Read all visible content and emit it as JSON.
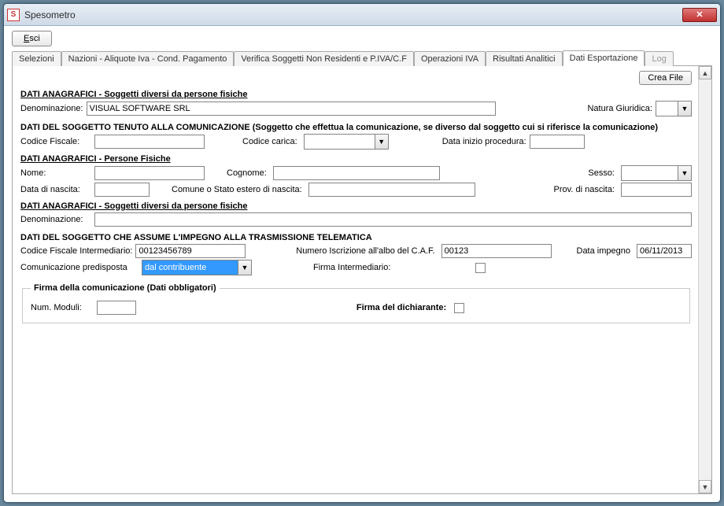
{
  "window": {
    "title": "Spesometro"
  },
  "toolbar": {
    "exit_pre": "E",
    "exit_rest": "sci"
  },
  "tabs": [
    {
      "label": "Selezioni"
    },
    {
      "label": "Nazioni - Aliquote Iva - Cond. Pagamento"
    },
    {
      "label": "Verifica Soggetti Non Residenti e P.IVA/C.F"
    },
    {
      "label": "Operazioni IVA"
    },
    {
      "label": "Risultati Analitici"
    },
    {
      "label": "Dati Esportazione"
    },
    {
      "label": "Log"
    }
  ],
  "buttons": {
    "crea_file": "Crea File"
  },
  "sec1": {
    "title": "DATI ANAGRAFICI - Soggetti diversi da persone fisiche",
    "denominazione_label": "Denominazione:",
    "denominazione_value": "VISUAL SOFTWARE SRL",
    "natura_label": "Natura Giuridica:",
    "natura_value": ""
  },
  "sec2": {
    "heading": "DATI DEL SOGGETTO TENUTO ALLA COMUNICAZIONE (Soggetto che effettua la comunicazione, se diverso dal soggetto cui si riferisce la comunicazione)",
    "codice_fiscale_label": "Codice Fiscale:",
    "codice_fiscale_value": "",
    "codice_carica_label": "Codice carica:",
    "codice_carica_value": "",
    "data_inizio_label": "Data inizio procedura:",
    "data_inizio_value": "",
    "persone_title": "DATI ANAGRAFICI - Persone Fisiche",
    "nome_label": "Nome:",
    "nome_value": "",
    "cognome_label": "Cognome:",
    "cognome_value": "",
    "sesso_label": "Sesso:",
    "sesso_value": "",
    "data_nascita_label": "Data di nascita:",
    "data_nascita_value": "",
    "comune_label": "Comune o Stato estero di nascita:",
    "comune_value": "",
    "prov_label": "Prov. di nascita:",
    "prov_value": "",
    "soggetti_title": "DATI ANAGRAFICI - Soggetti diversi da persone fisiche",
    "denom2_label": "Denominazione:",
    "denom2_value": ""
  },
  "sec3": {
    "heading": "DATI DEL SOGGETTO CHE ASSUME L'IMPEGNO ALLA TRASMISSIONE TELEMATICA",
    "cf_int_label": "Codice Fiscale Intermediario:",
    "cf_int_value": "00123456789",
    "num_iscr_label": "Numero Iscrizione all'albo del C.A.F.",
    "num_iscr_value": "00123",
    "data_impegno_label": "Data impegno",
    "data_impegno_value": "06/11/2013",
    "com_pred_label": "Comunicazione predisposta",
    "com_pred_value": "dal contribuente",
    "firma_int_label": "Firma Intermediario:"
  },
  "sec4": {
    "legend": "Firma della comunicazione (Dati obbligatori)",
    "num_moduli_label": "Num. Moduli:",
    "num_moduli_value": "",
    "firma_dich_label": "Firma del dichiarante:"
  }
}
